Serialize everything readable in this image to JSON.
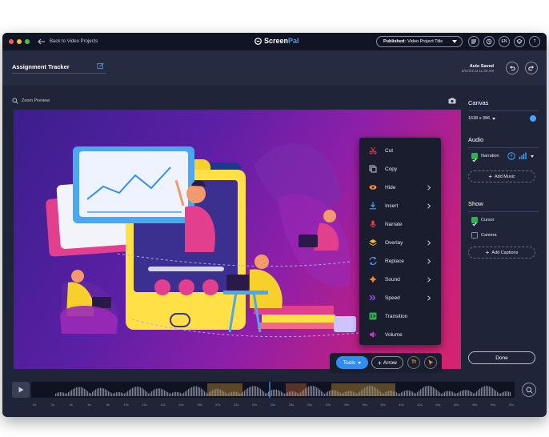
{
  "titlebar": {
    "back_label": "Back to Video Projects",
    "brand_screen": "Screen",
    "brand_pal": "Pal",
    "publish_prefix": "Published:",
    "publish_title": "Video Project Title",
    "language": "EN",
    "help": "?"
  },
  "project": {
    "title": "Assignment Tracker",
    "autosave_label": "Auto Saved",
    "autosave_time": "5/27/22 at 11:38 AM"
  },
  "preview": {
    "zoom_label": "Zoom Preview"
  },
  "context_menu": {
    "items": [
      {
        "label": "Cut",
        "icon": "scissors-icon",
        "submenu": false,
        "color": "#e0404a"
      },
      {
        "label": "Copy",
        "icon": "copy-icon",
        "submenu": false,
        "color": "#c8cbd8"
      },
      {
        "label": "Hide",
        "icon": "eye-icon",
        "submenu": true,
        "color": "#f28a30"
      },
      {
        "label": "Insert",
        "icon": "insert-icon",
        "submenu": true,
        "color": "#4aa3f5"
      },
      {
        "label": "Narrate",
        "icon": "microphone-icon",
        "submenu": false,
        "color": "#e0404a"
      },
      {
        "label": "Overlay",
        "icon": "layers-icon",
        "submenu": true,
        "color": "#f5b730"
      },
      {
        "label": "Replace",
        "icon": "replace-icon",
        "submenu": true,
        "color": "#4aa3f5"
      },
      {
        "label": "Sound",
        "icon": "sound-icon",
        "submenu": true,
        "color": "#f28a30"
      },
      {
        "label": "Speed",
        "icon": "speed-icon",
        "submenu": true,
        "color": "#a34af0"
      },
      {
        "label": "Transition",
        "icon": "transition-icon",
        "submenu": false,
        "color": "#2fb14e"
      },
      {
        "label": "Volume",
        "icon": "volume-icon",
        "submenu": false,
        "color": "#c040d0"
      }
    ]
  },
  "toolbar": {
    "tools_label": "Tools",
    "arrow_label": "Arrow",
    "text_tool": "Tt"
  },
  "panel": {
    "canvas_heading": "Canvas",
    "canvas_size": "1638 x 986",
    "audio_heading": "Audio",
    "narration_label": "Narration",
    "add_music_label": "Add Music",
    "show_heading": "Show",
    "cursor_label": "Cursor",
    "camera_label": "Camera",
    "add_captions_label": "Add Captions",
    "done_label": "Done"
  },
  "timeline": {
    "ticks": [
      "0s",
      "2s",
      "4s",
      "6s",
      "8s",
      "10s",
      "12s",
      "14s",
      "16s",
      "18s",
      "20s",
      "22s",
      "24s",
      "26s",
      "28s",
      "30s",
      "32s",
      "34s",
      "36s",
      "38s",
      "40s",
      "42s",
      "44s",
      "46s",
      "48s",
      "50s",
      "52s"
    ]
  }
}
